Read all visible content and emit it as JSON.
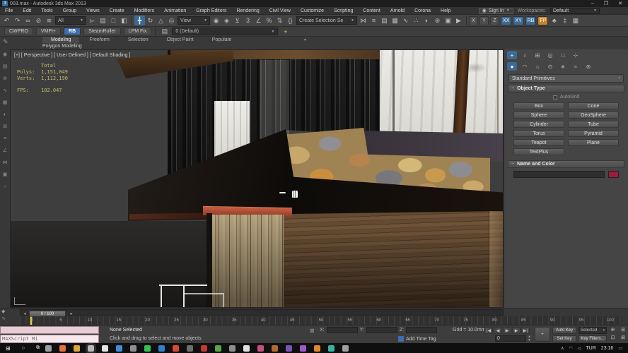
{
  "window": {
    "icon_label": "3",
    "title": "003.max - Autodesk 3ds Max 2013",
    "minimize": "–",
    "maximize": "❐",
    "close": "✕"
  },
  "menu": {
    "items": [
      "File",
      "Edit",
      "Tools",
      "Group",
      "Views",
      "Create",
      "Modifiers",
      "Animation",
      "Graph Editors",
      "Rendering",
      "Civil View",
      "Customize",
      "Scripting",
      "Content",
      "Arnold",
      "Corona",
      "Help"
    ],
    "sign_in": "Sign In",
    "workspaces_label": "Workspaces:",
    "workspace": "Default"
  },
  "main_toolbar": {
    "icons_left": [
      {
        "n": "undo-icon",
        "g": "↶"
      },
      {
        "n": "redo-icon",
        "g": "↷"
      },
      {
        "n": "select-and-link-icon",
        "g": "∞"
      },
      {
        "n": "unlink-selection-icon",
        "g": "⊘"
      },
      {
        "n": "bind-to-spacewarp-icon",
        "g": "≋"
      }
    ],
    "selection_filter": "All",
    "icons_select": [
      {
        "n": "select-object-icon",
        "g": "▻"
      },
      {
        "n": "select-by-name-icon",
        "g": "▤"
      },
      {
        "n": "rectangular-selection-region-icon",
        "g": "□"
      },
      {
        "n": "window-crossing-icon",
        "g": "◧"
      }
    ],
    "icons_transform": [
      {
        "n": "select-and-move-icon",
        "g": "╋",
        "active": true
      },
      {
        "n": "select-and-rotate-icon",
        "g": "↻"
      },
      {
        "n": "select-and-scale-icon",
        "g": "△"
      },
      {
        "n": "select-and-place-icon",
        "g": "◎"
      }
    ],
    "coord_system": "View",
    "icons_pivot": [
      {
        "n": "use-pivot-center-icon",
        "g": "◉"
      },
      {
        "n": "select-and-manipulate-icon",
        "g": "◈"
      },
      {
        "n": "keyboard-override-icon",
        "g": "⊻"
      },
      {
        "n": "snap-toggle-icon",
        "g": "3"
      },
      {
        "n": "angle-snap-icon",
        "g": "∠"
      },
      {
        "n": "percent-snap-icon",
        "g": "%"
      },
      {
        "n": "spinner-snap-icon",
        "g": "⇅"
      },
      {
        "n": "edit-named-sets-icon",
        "g": "{}"
      }
    ],
    "named_sets": "Create Selection Se",
    "icons_tools": [
      {
        "n": "mirror-icon",
        "g": "⋈"
      },
      {
        "n": "align-icon",
        "g": "≡"
      },
      {
        "n": "layer-manager-icon",
        "g": "▤"
      },
      {
        "n": "ribbon-toggle-icon",
        "g": "▦"
      },
      {
        "n": "curve-editor-icon",
        "g": "∿"
      },
      {
        "n": "schematic-view-icon",
        "g": "∴"
      },
      {
        "n": "material-editor-icon",
        "g": "◐"
      },
      {
        "n": "render-setup-icon",
        "g": "⊛"
      },
      {
        "n": "rendered-frame-icon",
        "g": "▣"
      },
      {
        "n": "render-icon",
        "g": "▶"
      }
    ],
    "axis_buttons": [
      {
        "label": "X"
      },
      {
        "label": "Y"
      },
      {
        "label": "Z"
      },
      {
        "label": "XX",
        "accent": true
      },
      {
        "label": "XY",
        "accent": true
      },
      {
        "label": "RB",
        "accent": true
      },
      {
        "label": "FP",
        "orange": true
      }
    ],
    "icons_right": [
      {
        "n": "tree-icon",
        "g": "♣"
      },
      {
        "n": "script-tool-icon",
        "g": "‡"
      },
      {
        "n": "grid-tool-icon",
        "g": "▦"
      }
    ]
  },
  "quick_access": {
    "buttons": [
      {
        "label": "CWPRO"
      },
      {
        "label": "VMPI+"
      },
      {
        "label": "RB",
        "accent": true
      },
      {
        "label": "SteamRoller"
      },
      {
        "label": "LPM Fix"
      }
    ],
    "layer_icon": "▤",
    "layer": "0 (Default)",
    "add_layer_icon": "+"
  },
  "ribbon": {
    "tabs": [
      {
        "label": "Modeling",
        "active": true
      },
      {
        "label": "Freeform"
      },
      {
        "label": "Selection"
      },
      {
        "label": "Object Paint"
      },
      {
        "label": "Populate"
      }
    ],
    "collapse_icon": "▾",
    "section": "Polygon Modeling",
    "pencil_icon": "✎"
  },
  "left_toolbar": {
    "icons": [
      {
        "n": "viewport-tool-1",
        "g": "◉"
      },
      {
        "n": "viewport-tool-2",
        "g": "▤"
      },
      {
        "n": "viewport-tool-3",
        "g": "⊕"
      },
      {
        "n": "viewport-tool-4",
        "g": "∿"
      },
      {
        "n": "viewport-tool-5",
        "g": "▦"
      },
      {
        "n": "viewport-tool-6",
        "g": "◐"
      },
      {
        "n": "viewport-tool-7",
        "g": "⊞"
      },
      {
        "n": "viewport-tool-8",
        "g": "≡"
      },
      {
        "n": "viewport-tool-9",
        "g": "∠"
      },
      {
        "n": "viewport-tool-10",
        "g": "⋈"
      },
      {
        "n": "viewport-tool-11",
        "g": "▣"
      },
      {
        "n": "viewport-tool-12",
        "g": "○"
      }
    ]
  },
  "viewport": {
    "label": "[+] [ Perspective ] [ User Defined ] [ Default Shading ]",
    "stats_header": "Total",
    "polys_label": "Polys:",
    "polys": "1,151,049",
    "verts_label": "Verts:",
    "verts": "1,112,190",
    "fps_label": "FPS:",
    "fps": "102.047"
  },
  "command_panel": {
    "tabs": [
      {
        "n": "tab-create",
        "g": "+",
        "active": true
      },
      {
        "n": "tab-modify",
        "g": "≀"
      },
      {
        "n": "tab-hierarchy",
        "g": "⊞"
      },
      {
        "n": "tab-motion",
        "g": "◎"
      },
      {
        "n": "tab-display",
        "g": "□"
      },
      {
        "n": "tab-utilities",
        "g": "⊹"
      }
    ],
    "categories": [
      {
        "n": "category-geometry",
        "g": "●",
        "active": true
      },
      {
        "n": "category-shapes",
        "g": "◠"
      },
      {
        "n": "category-lights",
        "g": "☼"
      },
      {
        "n": "category-cameras",
        "g": "⊙"
      },
      {
        "n": "category-helpers",
        "g": "∗"
      },
      {
        "n": "category-spacewarps",
        "g": "≈"
      },
      {
        "n": "category-systems",
        "g": "⊛"
      }
    ],
    "dropdown": "Standard Primitives",
    "dropdown_caret": "▾",
    "object_type": {
      "title": "Object Type",
      "collapse_sign": "−",
      "autogrid": "AutoGrid",
      "buttons": [
        "Box",
        "Cone",
        "Sphere",
        "GeoSphere",
        "Cylinder",
        "Tube",
        "Torus",
        "Pyramid",
        "Teapot",
        "Plane",
        "TextPlus"
      ]
    },
    "name_color": {
      "title": "Name and Color",
      "collapse_sign": "−",
      "swatch_color": "#9e1b3c"
    }
  },
  "timeline": {
    "icons": [
      {
        "n": "timeline-key-icon",
        "g": "◆"
      },
      {
        "n": "mini-curve-editor-icon",
        "g": "∿"
      }
    ],
    "scrubber": "0 / 100",
    "left_arrow": "◂",
    "right_arrow": "▸",
    "start": 0,
    "end": 100,
    "step": 5
  },
  "status_bar": {
    "maxscript": "MAXScript Mi",
    "status": "None Selected",
    "prompt": "Click and drag to select and move objects",
    "lock_icon": "⊠",
    "x_label": "X:",
    "x_value": "",
    "y_label": "Y:",
    "y_value": "",
    "z_label": "Z:",
    "z_value": "",
    "grid": "Grid = 10.0mm",
    "add_time_tag": "Add Time Tag",
    "playback": [
      {
        "n": "go-to-start-icon",
        "g": "|◀"
      },
      {
        "n": "previous-frame-icon",
        "g": "◀"
      },
      {
        "n": "play-icon",
        "g": "▶"
      },
      {
        "n": "next-frame-icon",
        "g": "▶"
      },
      {
        "n": "go-to-end-icon",
        "g": "▶|"
      }
    ],
    "frame": "0",
    "set_key_big_icon": "+",
    "auto_key": "Auto Key",
    "set_key": "Set Key",
    "key_mode": "Selected",
    "key_mode_caret": "▾",
    "key_filters": "Key Filters...",
    "nav": [
      {
        "n": "zoom-icon",
        "g": "⊕"
      },
      {
        "n": "zoom-all-icon",
        "g": "⊞"
      },
      {
        "n": "zoom-extents-icon",
        "g": "⊡"
      },
      {
        "n": "zoom-region-icon",
        "g": "⊠"
      },
      {
        "n": "pan-icon",
        "g": "▦"
      },
      {
        "n": "walk-through-icon",
        "g": "◉"
      },
      {
        "n": "orbit-icon",
        "g": "↻"
      },
      {
        "n": "maximize-viewport-icon",
        "g": "◰"
      }
    ]
  },
  "taskbar": {
    "start_icon": "⊞",
    "search_icon": "○",
    "taskview_icon": "⧉",
    "apps": [
      {
        "n": "app-1",
        "c": "#9aa0a6"
      },
      {
        "n": "app-firefox",
        "c": "#e8703a"
      },
      {
        "n": "app-folder",
        "c": "#dca73c"
      },
      {
        "n": "app-3dsmax",
        "c": "#b9b9b9",
        "active": true
      },
      {
        "n": "app-notepad",
        "c": "#e4e4e4"
      },
      {
        "n": "app-6",
        "c": "#3f8fd6"
      },
      {
        "n": "app-7",
        "c": "#8a8f94"
      },
      {
        "n": "app-whatsapp",
        "c": "#35c151"
      },
      {
        "n": "app-9",
        "c": "#2f7fd0"
      },
      {
        "n": "app-10",
        "c": "#d9473b"
      },
      {
        "n": "app-11",
        "c": "#6e6e6e"
      },
      {
        "n": "app-adobe",
        "c": "#c33931"
      },
      {
        "n": "app-13",
        "c": "#57a744"
      },
      {
        "n": "app-14",
        "c": "#8d8d8d"
      },
      {
        "n": "app-15",
        "c": "#e0e0e0"
      },
      {
        "n": "app-16",
        "c": "#c94f7c"
      },
      {
        "n": "app-17",
        "c": "#b06a32"
      },
      {
        "n": "app-18",
        "c": "#7a52b8"
      },
      {
        "n": "app-19",
        "c": "#9c59c9"
      },
      {
        "n": "app-20",
        "c": "#e0862f"
      },
      {
        "n": "app-21",
        "c": "#39b0a3"
      },
      {
        "n": "app-22",
        "c": "#a0a0a0"
      }
    ],
    "tray": {
      "caret": "∧",
      "net_icon": "◠",
      "vol_icon": "◁",
      "lang": "TUR",
      "time": "23:16",
      "notif_icon": "▭"
    }
  }
}
